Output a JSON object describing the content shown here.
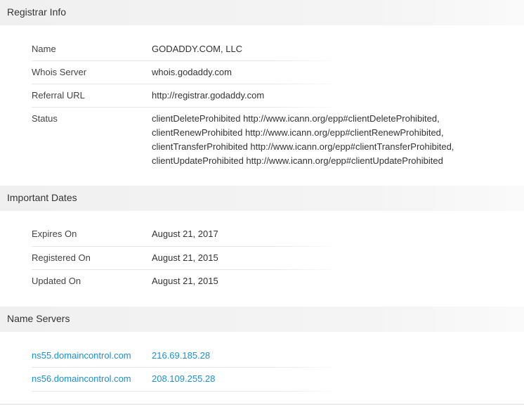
{
  "registrar_info": {
    "title": "Registrar Info",
    "rows": [
      {
        "label": "Name",
        "value": "GODADDY.COM, LLC"
      },
      {
        "label": "Whois Server",
        "value": "whois.godaddy.com"
      },
      {
        "label": "Referral URL",
        "value": "http://registrar.godaddy.com"
      },
      {
        "label": "Status",
        "lines": [
          "clientDeleteProhibited http://www.icann.org/epp#clientDeleteProhibited,",
          "clientRenewProhibited http://www.icann.org/epp#clientRenewProhibited,",
          "clientTransferProhibited http://www.icann.org/epp#clientTransferProhibited,",
          "clientUpdateProhibited http://www.icann.org/epp#clientUpdateProhibited"
        ]
      }
    ]
  },
  "important_dates": {
    "title": "Important Dates",
    "rows": [
      {
        "label": "Expires On",
        "value": "August 21, 2017"
      },
      {
        "label": "Registered On",
        "value": "August 21, 2015"
      },
      {
        "label": "Updated On",
        "value": "August 21, 2015"
      }
    ]
  },
  "name_servers": {
    "title": "Name Servers",
    "rows": [
      {
        "host": "ns55.domaincontrol.com",
        "ip": "216.69.185.28"
      },
      {
        "host": "ns56.domaincontrol.com",
        "ip": "208.109.255.28"
      }
    ]
  },
  "colors": {
    "link": "#1a8fd6",
    "header_bg": "#f0f0f0",
    "text": "#333333"
  }
}
